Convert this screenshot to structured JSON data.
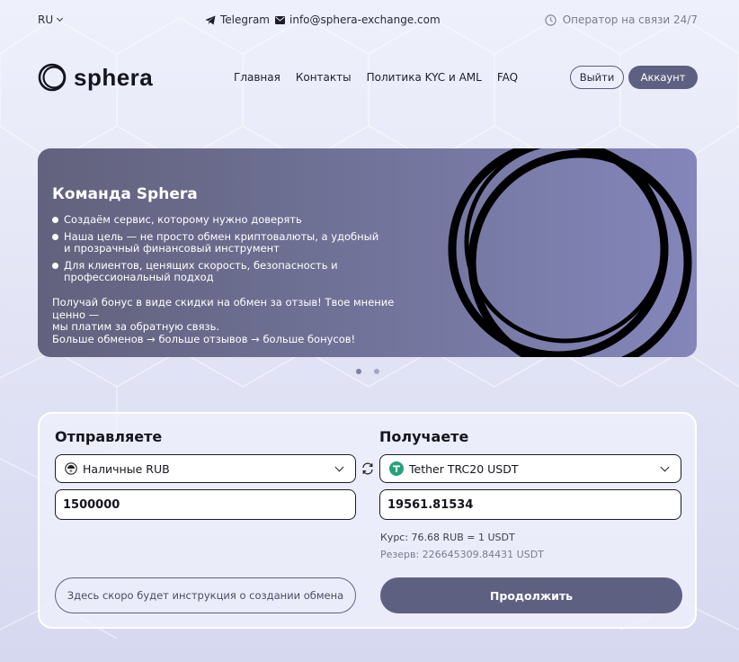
{
  "topbar": {
    "lang": "RU",
    "telegram": "Telegram",
    "email": "info@sphera-exchange.com",
    "operator": "Оператор на связи 24/7"
  },
  "header": {
    "logo": "sphera",
    "nav": [
      "Главная",
      "Контакты",
      "Политика KYC и AML",
      "FAQ"
    ],
    "logout": "Выйти",
    "account": "Аккаунт"
  },
  "banner": {
    "title": "Команда Sphera",
    "bullets": [
      "Создаём сервис, которому нужно доверять",
      "Наша цель — не просто обмен криптовалюты, а удобный и прозрачный финансовый инструмент",
      "Для клиентов, ценящих скорость, безопасность и профессиональный подход"
    ],
    "promo": [
      "Получай бонус в виде скидки на обмен за отзыв! Твое мнение ценно —",
      "мы платим за обратную связь.",
      "Больше обменов → больше отзывов → больше бонусов!"
    ],
    "slides_total": 2,
    "active_slide": 1
  },
  "exchange": {
    "send_title": "Отправляете",
    "receive_title": "Получаете",
    "send_currency": "Наличные RUB",
    "receive_currency": "Tether TRC20 USDT",
    "send_amount": "1500000",
    "receive_amount": "19561.81534",
    "rate": "Курс: 76.68 RUB = 1 USDT",
    "reserve": "Резерв: 226645309.84431 USDT",
    "hint_button": "Здесь скоро будет инструкция о создании обмена",
    "continue_button": "Продолжить"
  },
  "colors": {
    "accent": "#5e6082",
    "tether": "#26a17b",
    "banner_start": "#62627d",
    "banner_end": "#8486bb"
  }
}
